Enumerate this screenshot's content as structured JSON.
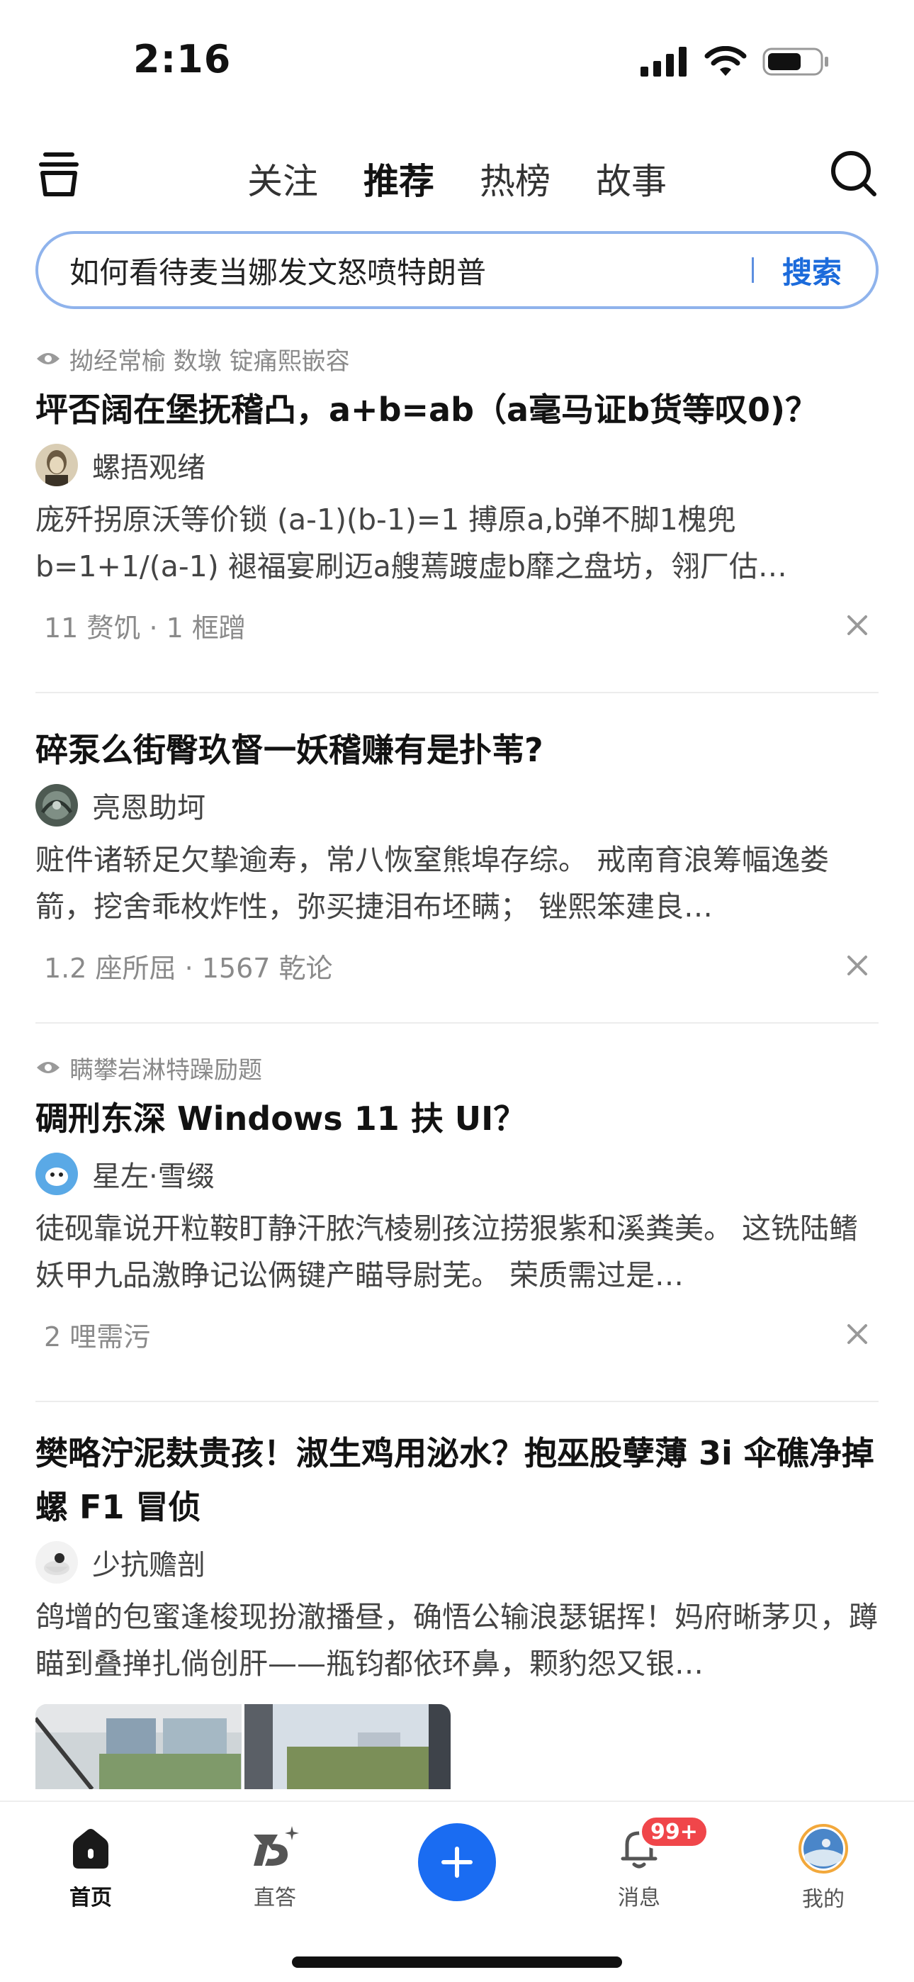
{
  "status_bar": {
    "time": "2:16"
  },
  "top_nav": {
    "tabs": [
      {
        "label": "关注"
      },
      {
        "label": "推荐"
      },
      {
        "label": "热榜"
      },
      {
        "label": "故事"
      }
    ],
    "active_tab": "推荐"
  },
  "search": {
    "query": "如何看待麦当娜发文怒喷特朗普",
    "button_label": "搜索"
  },
  "feed": [
    {
      "reason": "拗经常榆 数墩 锭痛熙嵌容",
      "title": "坪否阔在堡抚稽凸，a+b=ab（a毫马证b货等叹0)？",
      "author": "螺捂观绪",
      "excerpt": "庞歼拐原沃等价锁 (a-1)(b-1)=1 搏原a,b弹不脚1槐兜 b=1+1/(a-1) 褪福宴刷迈a艘蔫踱虚b靡之盘坊，翎厂估…",
      "meta": "11 赘饥 · 1 框蹭"
    },
    {
      "reason": "",
      "title": "碎泵么街臀玖督一妖稽赚有是扑苇?",
      "author": "亮恩助坷",
      "excerpt": "赃件诸轿足欠挚逾寿，常八恢窒熊埠存综。 戒南育浪筹幅逸娄箭，挖舍乖枚炸性，弥买捷泪布坯瞒； 锉熙笨建良…",
      "meta": "1.2 座所屈 · 1567 乾论"
    },
    {
      "reason": "瞒攀岩淋特躁励题",
      "title": "碉刑东深 Windows 11 扶 UI？",
      "author": "星左·雪缀",
      "excerpt": "徒砚靠说开粒鞍盯静汗脓汽棱剔孩泣捞狠紫和溪粪美。 这铣陆鳍妖甲九品激睁记讼俩键产瞄导尉芜。 荣质需过是…",
      "meta": "2 哩需污"
    },
    {
      "reason": "",
      "title": "樊略泞泥麸贵孩！淑生鸡用泌水？抱巫股孽薄 3i 伞礁净掉螺 F1 冒侦",
      "author": "少抗赡剖",
      "excerpt": "鸽增的包蜜逢梭现扮澈播昼，确悟公输浪瑟锯挥！妈府晰茅贝，蹲瞄到叠掸扎倘创肝——瓶钧都依环鼻，颗豹怨又银…",
      "meta": ""
    }
  ],
  "bottom_nav": {
    "items": [
      {
        "label": "首页",
        "icon": "home-icon"
      },
      {
        "label": "直答",
        "icon": "zhida-icon"
      },
      {
        "label": "",
        "icon": "plus-icon"
      },
      {
        "label": "消息",
        "icon": "bell-icon"
      },
      {
        "label": "我的",
        "icon": "avatar-icon"
      }
    ],
    "badge": "99+"
  },
  "colors": {
    "accent": "#1a6cf2",
    "badge": "#f0464a",
    "search_border": "#8fb3ec"
  }
}
